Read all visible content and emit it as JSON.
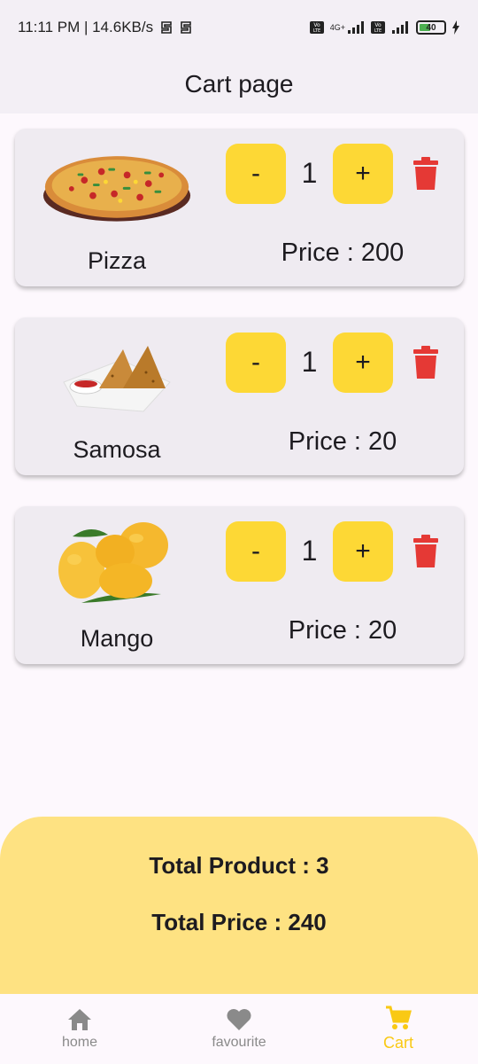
{
  "status_bar": {
    "time_speed": "11:11 PM | 14.6KB/s",
    "network_label": "4G+",
    "battery": "40"
  },
  "app_bar": {
    "title": "Cart page"
  },
  "cart_items": [
    {
      "name": "Pizza",
      "quantity": "1",
      "price": "Price : 200",
      "minus": "-",
      "plus": "+",
      "image_icon": "pizza-image"
    },
    {
      "name": "Samosa",
      "quantity": "1",
      "price": "Price : 20",
      "minus": "-",
      "plus": "+",
      "image_icon": "samosa-image"
    },
    {
      "name": "Mango",
      "quantity": "1",
      "price": "Price : 20",
      "minus": "-",
      "plus": "+",
      "image_icon": "mango-image"
    }
  ],
  "summary": {
    "total_product": "Total Product : 3",
    "total_price": "Total Price : 240"
  },
  "bottom_nav": {
    "items": [
      {
        "label": "home",
        "icon": "home-icon"
      },
      {
        "label": "favourite",
        "icon": "heart-icon"
      },
      {
        "label": "Cart",
        "icon": "cart-icon"
      }
    ],
    "active": "Cart"
  },
  "colors": {
    "accent_yellow": "#fdd835",
    "summary_bg": "#fee282",
    "delete_red": "#e53935",
    "nav_active": "#f9c914"
  }
}
